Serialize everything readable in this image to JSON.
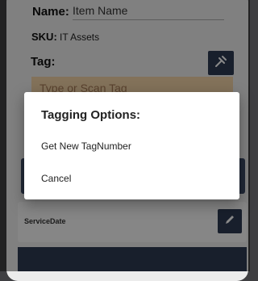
{
  "form": {
    "name_label": "Name:",
    "name_value": "Item Name",
    "sku_label": "SKU:",
    "sku_value": "IT Assets",
    "tag_label": "Tag:",
    "tag_placeholder": "Type or Scan Tag",
    "service_date_label": "ServiceDate"
  },
  "dialog": {
    "title": "Tagging Options:",
    "options": [
      "Get New TagNumber",
      "Cancel"
    ]
  },
  "icons": {
    "tag_button": "scan-icon",
    "service_date_button": "pencil-icon"
  },
  "colors": {
    "primary_button": "#2e3a52",
    "tag_input_bg": "#f3d3a7"
  }
}
